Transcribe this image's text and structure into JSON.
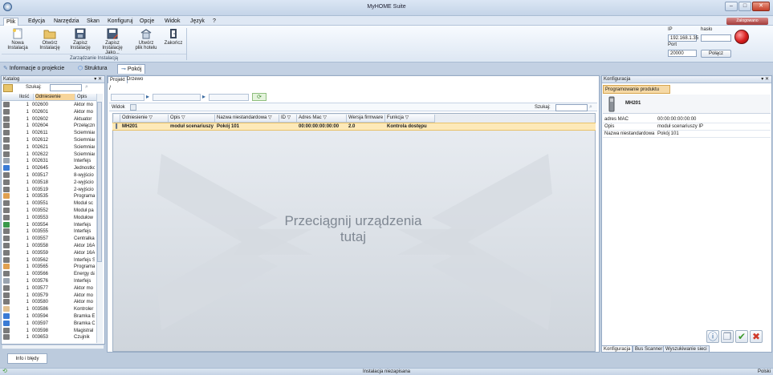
{
  "window": {
    "title": "MyHOME Suite",
    "user_tag": "Zalogowano"
  },
  "menu": [
    "Plik",
    "Edycja",
    "Narzędzia",
    "Skan",
    "Konfiguruj",
    "Opcje",
    "Widok",
    "Język",
    "?"
  ],
  "ribbon": {
    "buttons": [
      {
        "line1": "Nowa",
        "line2": "Instalacja"
      },
      {
        "line1": "Otwórz",
        "line2": "Instalację"
      },
      {
        "line1": "Zapisz",
        "line2": "Instalację"
      },
      {
        "line1": "Zapisz",
        "line2": "Instalację Jako..."
      },
      {
        "line1": "Utwórz",
        "line2": "plik hotelu"
      },
      {
        "line1": "Zakończ",
        "line2": ""
      }
    ],
    "group_label": "Zarządzanie Instalacją"
  },
  "connection": {
    "ip_label": "IP",
    "ip_value": "192.168.1.35",
    "password_label": "hasło",
    "port_label": "Port",
    "port_value": "20000",
    "connect_label": "Połącz"
  },
  "top_tabs": [
    "Informacje o projekcie",
    "Struktura",
    "Pokój"
  ],
  "catalog": {
    "title": "Katalog",
    "controls": "▾ ✕",
    "search_label": "Szukaj:",
    "columns": [
      "Ilość",
      "Odniesienie",
      "Opis"
    ],
    "rows": [
      {
        "qty": "1",
        "ref": "002600",
        "desc": "Aktor mo",
        "color": "#7a7a7a"
      },
      {
        "qty": "1",
        "ref": "002601",
        "desc": "Aktor mo",
        "color": "#7a7a7a"
      },
      {
        "qty": "1",
        "ref": "002602",
        "desc": "Aktuator",
        "color": "#7a7a7a"
      },
      {
        "qty": "1",
        "ref": "002604",
        "desc": "Przełączn",
        "color": "#7a7a7a"
      },
      {
        "qty": "1",
        "ref": "002611",
        "desc": "Ściemniac",
        "color": "#7a7a7a"
      },
      {
        "qty": "1",
        "ref": "002612",
        "desc": "Ściemniac",
        "color": "#7a7a7a"
      },
      {
        "qty": "1",
        "ref": "002621",
        "desc": "Ściemniac",
        "color": "#7a7a7a"
      },
      {
        "qty": "1",
        "ref": "002622",
        "desc": "Ściemniac",
        "color": "#7a7a7a"
      },
      {
        "qty": "1",
        "ref": "002631",
        "desc": "Interfejs",
        "color": "#9aa4b0"
      },
      {
        "qty": "1",
        "ref": "002645",
        "desc": "Jednostkc",
        "color": "#3a7bd5"
      },
      {
        "qty": "1",
        "ref": "003517",
        "desc": "8-wyjścio",
        "color": "#7a7a7a"
      },
      {
        "qty": "1",
        "ref": "003518",
        "desc": "2-wyjścio",
        "color": "#7a7a7a"
      },
      {
        "qty": "1",
        "ref": "003519",
        "desc": "2-wyjścio",
        "color": "#7a7a7a"
      },
      {
        "qty": "1",
        "ref": "003535",
        "desc": "Programa",
        "color": "#e0a050"
      },
      {
        "qty": "1",
        "ref": "003551",
        "desc": "Moduł sc",
        "color": "#7a7a7a"
      },
      {
        "qty": "1",
        "ref": "003552",
        "desc": "Moduł pa",
        "color": "#7a7a7a"
      },
      {
        "qty": "1",
        "ref": "003553",
        "desc": "Modułow",
        "color": "#7a7a7a"
      },
      {
        "qty": "1",
        "ref": "003554",
        "desc": "Interfejs",
        "color": "#3a9a4a"
      },
      {
        "qty": "1",
        "ref": "003555",
        "desc": "Interfejs",
        "color": "#7a7a7a"
      },
      {
        "qty": "1",
        "ref": "003557",
        "desc": "Centralka",
        "color": "#7a7a7a"
      },
      {
        "qty": "1",
        "ref": "003558",
        "desc": "Aktor 16A",
        "color": "#7a7a7a"
      },
      {
        "qty": "1",
        "ref": "003559",
        "desc": "Aktor 16A",
        "color": "#7a7a7a"
      },
      {
        "qty": "1",
        "ref": "003562",
        "desc": "Interfejs S",
        "color": "#7a7a7a"
      },
      {
        "qty": "1",
        "ref": "003565",
        "desc": "Programa",
        "color": "#e0a050"
      },
      {
        "qty": "1",
        "ref": "003566",
        "desc": "Energy da",
        "color": "#7a7a7a"
      },
      {
        "qty": "1",
        "ref": "003576",
        "desc": "Interfejs",
        "color": "#9aa4b0"
      },
      {
        "qty": "1",
        "ref": "003577",
        "desc": "Aktor mo",
        "color": "#7a7a7a"
      },
      {
        "qty": "1",
        "ref": "003579",
        "desc": "Aktor mo",
        "color": "#7a7a7a"
      },
      {
        "qty": "1",
        "ref": "003580",
        "desc": "Aktor mo",
        "color": "#7a7a7a"
      },
      {
        "qty": "1",
        "ref": "003586",
        "desc": "Kontroler",
        "color": "#e0c090"
      },
      {
        "qty": "1",
        "ref": "003594",
        "desc": "Bramka E",
        "color": "#3a7bd5"
      },
      {
        "qty": "1",
        "ref": "003597",
        "desc": "Bramka C",
        "color": "#3a7bd5"
      },
      {
        "qty": "1",
        "ref": "003598",
        "desc": "Magistral",
        "color": "#7a7a7a"
      },
      {
        "qty": "1",
        "ref": "003653",
        "desc": "Czujnik",
        "color": "#7a7a7a"
      }
    ]
  },
  "info_tab": "Info i błędy",
  "center": {
    "tabs": [
      "Projekt",
      "Drzewo"
    ],
    "path": "/",
    "widok_label": "Widok",
    "search_label": "Szukaj:",
    "columns": [
      "Odniesienie",
      "Opis",
      "Nazwa niestandardowa",
      "ID",
      "Adres Mac",
      "Wersja firmware",
      "Funkcja"
    ],
    "row": {
      "ref": "MH201",
      "desc": "moduł scenariuszy IP",
      "name": "Pokój 101",
      "id": "",
      "mac": "00:00:00:00:00:00",
      "fw": "2.0",
      "func": "Kontrola dostępu"
    },
    "drop_text_1": "Przeciągnij urządzenia",
    "drop_text_2": "tutaj"
  },
  "right": {
    "title": "Konfiguracja",
    "controls": "▾ ✕",
    "prog_tab": "Programowanie produktu",
    "device": "MH201",
    "props": [
      {
        "k": "adres MAC",
        "v": "00:00:00:00:00:00"
      },
      {
        "k": "Opis",
        "v": "moduł scenariuszy IP"
      },
      {
        "k": "Nazwa niestandardowa",
        "v": "Pokój 101"
      }
    ],
    "bottom_tabs": [
      "Konfiguracja",
      "Bus Scanner",
      "Wyszukiwanie sieci"
    ]
  },
  "status": {
    "center": "Instalacja niezapisana",
    "right": "Polski"
  },
  "colors": {
    "accent": "#4a78b4",
    "selection": "#fde9b8",
    "tab_active": "#f5d9a6"
  }
}
